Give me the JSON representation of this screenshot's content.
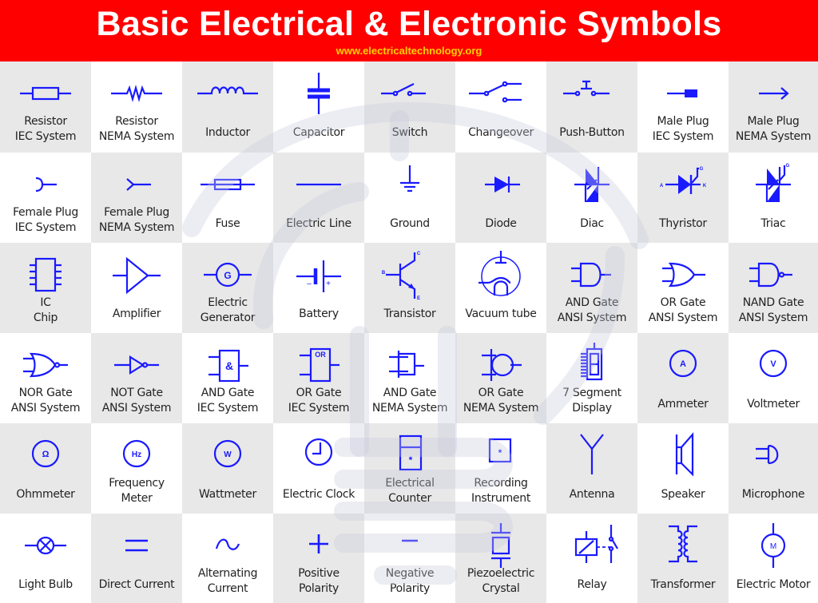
{
  "header": {
    "title": "Basic Electrical & Electronic Symbols",
    "url": "www.electricaltechnology.org"
  },
  "colors": {
    "header_bg": "#ff0000",
    "title_text": "#ffffff",
    "url_text": "#ffd000",
    "symbol": "#1a1aff",
    "cell_gray": "#e8e8e8",
    "cell_white": "#ffffff",
    "watermark": "#c8c8dc"
  },
  "symbols": [
    {
      "icon": "resistor-iec-icon",
      "lines": [
        "Resistor",
        "IEC System"
      ]
    },
    {
      "icon": "resistor-nema-icon",
      "lines": [
        "Resistor",
        "NEMA System"
      ]
    },
    {
      "icon": "inductor-icon",
      "lines": [
        "Inductor"
      ]
    },
    {
      "icon": "capacitor-icon",
      "lines": [
        "Capacitor"
      ]
    },
    {
      "icon": "switch-icon",
      "lines": [
        "Switch"
      ]
    },
    {
      "icon": "changeover-icon",
      "lines": [
        "Changeover"
      ]
    },
    {
      "icon": "push-button-icon",
      "lines": [
        "Push-Button"
      ]
    },
    {
      "icon": "male-plug-iec-icon",
      "lines": [
        "Male Plug",
        "IEC System"
      ]
    },
    {
      "icon": "male-plug-nema-icon",
      "lines": [
        "Male Plug",
        "NEMA System"
      ]
    },
    {
      "icon": "female-plug-iec-icon",
      "lines": [
        "Female Plug",
        "IEC System"
      ]
    },
    {
      "icon": "female-plug-nema-icon",
      "lines": [
        "Female Plug",
        "NEMA System"
      ]
    },
    {
      "icon": "fuse-icon",
      "lines": [
        "Fuse"
      ]
    },
    {
      "icon": "electric-line-icon",
      "lines": [
        "Electric Line"
      ]
    },
    {
      "icon": "ground-icon",
      "lines": [
        "Ground"
      ]
    },
    {
      "icon": "diode-icon",
      "lines": [
        "Diode"
      ]
    },
    {
      "icon": "diac-icon",
      "lines": [
        "Diac"
      ]
    },
    {
      "icon": "thyristor-icon",
      "lines": [
        "Thyristor"
      ],
      "pins": {
        "a": "A",
        "k": "K",
        "g": "G"
      }
    },
    {
      "icon": "triac-icon",
      "lines": [
        "Triac"
      ],
      "pins": {
        "g": "G"
      }
    },
    {
      "icon": "ic-chip-icon",
      "lines": [
        "IC",
        "Chip"
      ]
    },
    {
      "icon": "amplifier-icon",
      "lines": [
        "Amplifier"
      ]
    },
    {
      "icon": "electric-generator-icon",
      "lines": [
        "Electric",
        "Generator"
      ],
      "glyph": "G"
    },
    {
      "icon": "battery-icon",
      "lines": [
        "Battery"
      ],
      "pins": {
        "neg": "–",
        "pos": "+"
      }
    },
    {
      "icon": "transistor-icon",
      "lines": [
        "Transistor"
      ],
      "pins": {
        "b": "B",
        "c": "C",
        "e": "E"
      }
    },
    {
      "icon": "vacuum-tube-icon",
      "lines": [
        "Vacuum tube"
      ]
    },
    {
      "icon": "and-gate-ansi-icon",
      "lines": [
        "AND Gate",
        "ANSI System"
      ]
    },
    {
      "icon": "or-gate-ansi-icon",
      "lines": [
        "OR Gate",
        "ANSI System"
      ]
    },
    {
      "icon": "nand-gate-ansi-icon",
      "lines": [
        "NAND Gate",
        "ANSI System"
      ]
    },
    {
      "icon": "nor-gate-ansi-icon",
      "lines": [
        "NOR Gate",
        "ANSI System"
      ]
    },
    {
      "icon": "not-gate-ansi-icon",
      "lines": [
        "NOT Gate",
        "ANSI System"
      ]
    },
    {
      "icon": "and-gate-iec-icon",
      "lines": [
        "AND Gate",
        "IEC System"
      ],
      "glyph": "&"
    },
    {
      "icon": "or-gate-iec-icon",
      "lines": [
        "OR Gate",
        "IEC System"
      ],
      "glyph": "OR"
    },
    {
      "icon": "and-gate-nema-icon",
      "lines": [
        "AND Gate",
        "NEMA System"
      ]
    },
    {
      "icon": "or-gate-nema-icon",
      "lines": [
        "OR Gate",
        "NEMA System"
      ]
    },
    {
      "icon": "seven-segment-display-icon",
      "lines": [
        "7 Segment",
        "Display"
      ]
    },
    {
      "icon": "ammeter-icon",
      "lines": [
        "Ammeter"
      ],
      "glyph": "A"
    },
    {
      "icon": "voltmeter-icon",
      "lines": [
        "Voltmeter"
      ],
      "glyph": "V"
    },
    {
      "icon": "ohmmeter-icon",
      "lines": [
        "Ohmmeter"
      ],
      "glyph": "Ω"
    },
    {
      "icon": "frequency-meter-icon",
      "lines": [
        "Frequency",
        "Meter"
      ],
      "glyph": "Hz"
    },
    {
      "icon": "wattmeter-icon",
      "lines": [
        "Wattmeter"
      ],
      "glyph": "W"
    },
    {
      "icon": "electric-clock-icon",
      "lines": [
        "Electric Clock"
      ]
    },
    {
      "icon": "electrical-counter-icon",
      "lines": [
        "Electrical",
        "Counter"
      ],
      "glyph": "*"
    },
    {
      "icon": "recording-instrument-icon",
      "lines": [
        "Recording",
        "Instrument"
      ],
      "glyph": "*"
    },
    {
      "icon": "antenna-icon",
      "lines": [
        "Antenna"
      ]
    },
    {
      "icon": "speaker-icon",
      "lines": [
        "Speaker"
      ]
    },
    {
      "icon": "microphone-icon",
      "lines": [
        "Microphone"
      ]
    },
    {
      "icon": "light-bulb-icon",
      "lines": [
        "Light Bulb"
      ]
    },
    {
      "icon": "direct-current-icon",
      "lines": [
        "Direct Current"
      ]
    },
    {
      "icon": "alternating-current-icon",
      "lines": [
        "Alternating",
        "Current"
      ]
    },
    {
      "icon": "positive-polarity-icon",
      "lines": [
        "Positive",
        "Polarity"
      ]
    },
    {
      "icon": "negative-polarity-icon",
      "lines": [
        "Negative",
        "Polarity"
      ]
    },
    {
      "icon": "piezoelectric-crystal-icon",
      "lines": [
        "Piezoelectric",
        "Crystal"
      ]
    },
    {
      "icon": "relay-icon",
      "lines": [
        "Relay"
      ]
    },
    {
      "icon": "transformer-icon",
      "lines": [
        "Transformer"
      ]
    },
    {
      "icon": "electric-motor-icon",
      "lines": [
        "Electric Motor"
      ],
      "glyph": "M"
    }
  ]
}
